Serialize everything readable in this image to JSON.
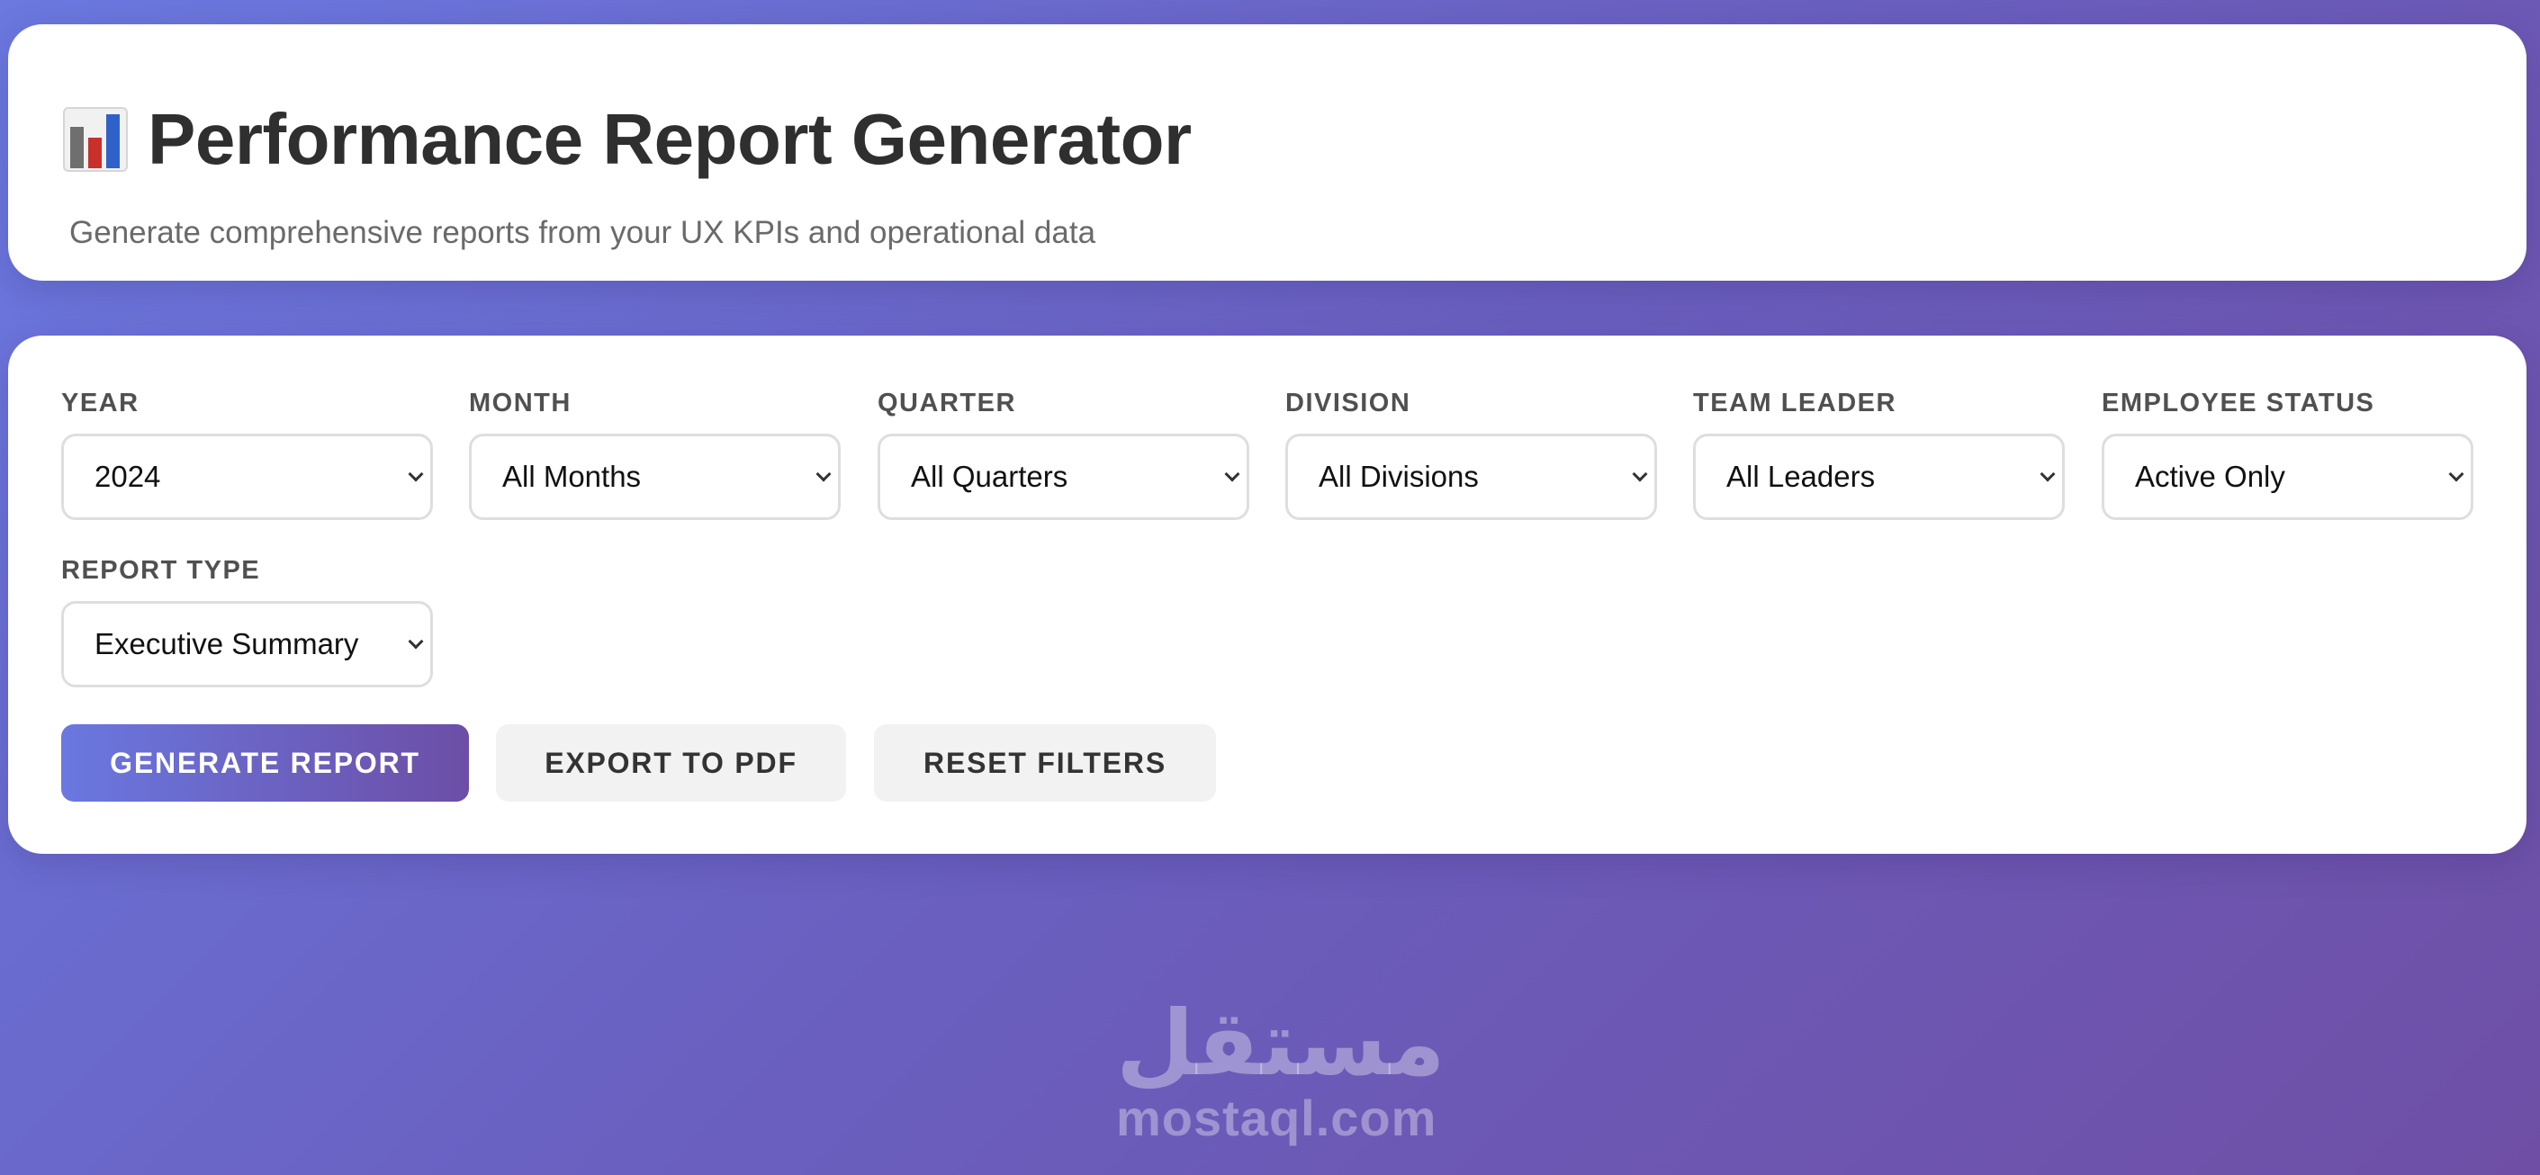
{
  "header": {
    "title": "Performance Report Generator",
    "subtitle": "Generate comprehensive reports from your UX KPIs and operational data",
    "icon": "bar-chart-icon"
  },
  "filters": {
    "year": {
      "label": "YEAR",
      "value": "2024"
    },
    "month": {
      "label": "MONTH",
      "value": "All Months"
    },
    "quarter": {
      "label": "QUARTER",
      "value": "All Quarters"
    },
    "division": {
      "label": "DIVISION",
      "value": "All Divisions"
    },
    "team_leader": {
      "label": "TEAM LEADER",
      "value": "All Leaders"
    },
    "employee_status": {
      "label": "EMPLOYEE STATUS",
      "value": "Active Only"
    },
    "report_type": {
      "label": "REPORT TYPE",
      "value": "Executive Summary"
    }
  },
  "actions": {
    "generate": "GENERATE REPORT",
    "export": "EXPORT TO PDF",
    "reset": "RESET FILTERS"
  },
  "watermark": {
    "arabic": "مستقل",
    "latin": "mostaql.com"
  },
  "colors": {
    "background_start": "#6b79e0",
    "background_end": "#6f4fa6",
    "primary_button_start": "#6a78e0",
    "primary_button_end": "#6c4ea6",
    "secondary_button": "#f2f2f2"
  }
}
